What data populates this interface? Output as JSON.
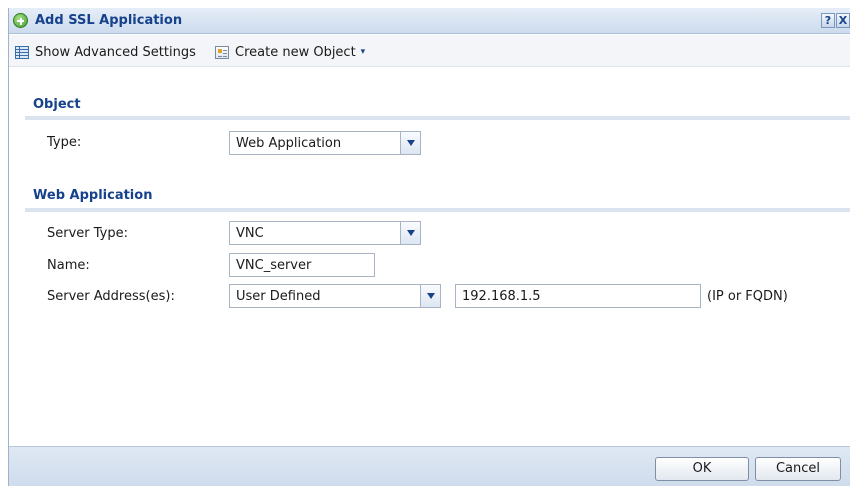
{
  "dialog": {
    "title": "Add SSL Application",
    "help_glyph": "?",
    "close_glyph": "X"
  },
  "toolbar": {
    "show_advanced": "Show Advanced Settings",
    "create_new_object": "Create new Object",
    "create_caret": "▾"
  },
  "sections": {
    "object": {
      "title": "Object",
      "type_label": "Type:",
      "type_value": "Web Application"
    },
    "web_application": {
      "title": "Web Application",
      "server_type_label": "Server Type:",
      "server_type_value": "VNC",
      "name_label": "Name:",
      "name_value": "VNC_server",
      "server_address_label": "Server Address(es):",
      "server_address_mode": "User Defined",
      "server_address_value": "192.168.1.5",
      "server_address_hint": "(IP or FQDN)"
    }
  },
  "footer": {
    "ok_label": "OK",
    "cancel_label": "Cancel"
  },
  "icons": {
    "title": "add-circle-icon",
    "advanced": "grid-icon",
    "create": "new-object-icon",
    "dropdown": "chevron-down-icon"
  },
  "colors": {
    "title_text": "#15428b",
    "titlebar_bg": "#dbe5f3",
    "section_line": "#dbe3ee",
    "footer_bg": "#d7e2ef"
  }
}
